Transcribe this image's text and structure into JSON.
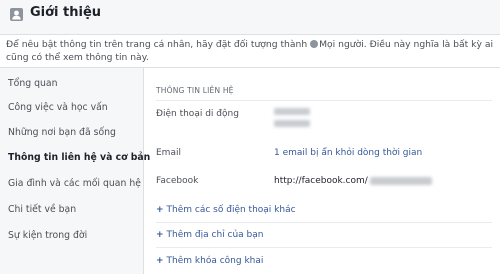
{
  "header": {
    "title": "Giới thiệu",
    "icon": "profile-icon"
  },
  "notice": {
    "text_before": "Để nêu bật thông tin trên trang cá nhân, hãy đặt đối tượng thành ",
    "audience": "Mọi người",
    "text_after": ". Điều này nghĩa là bất kỳ ai cũng có thể xem thông tin này."
  },
  "sidebar": {
    "items": [
      {
        "label": "Tổng quan"
      },
      {
        "label": "Công việc và học vấn"
      },
      {
        "label": "Những nơi bạn đã sống"
      },
      {
        "label": "Thông tin liên hệ và cơ bản",
        "active": true
      },
      {
        "label": "Gia đình và các mối quan hệ"
      },
      {
        "label": "Chi tiết về bạn"
      },
      {
        "label": "Sự kiện trong đời"
      }
    ]
  },
  "contact": {
    "section_title": "THÔNG TIN LIÊN HỆ",
    "phone_label": "Điện thoại di động",
    "email_label": "Email",
    "email_value": "1 email bị ẩn khỏi dòng thời gian",
    "facebook_label": "Facebook",
    "facebook_value": "http://facebook.com/",
    "add_links": [
      {
        "label": "Thêm các số điện thoại khác"
      },
      {
        "label": "Thêm địa chỉ của bạn"
      },
      {
        "label": "Thêm khóa công khai"
      }
    ]
  },
  "colors": {
    "link": "#365899",
    "sidebar_bg": "#f6f7f9",
    "border": "#dddfe2"
  }
}
